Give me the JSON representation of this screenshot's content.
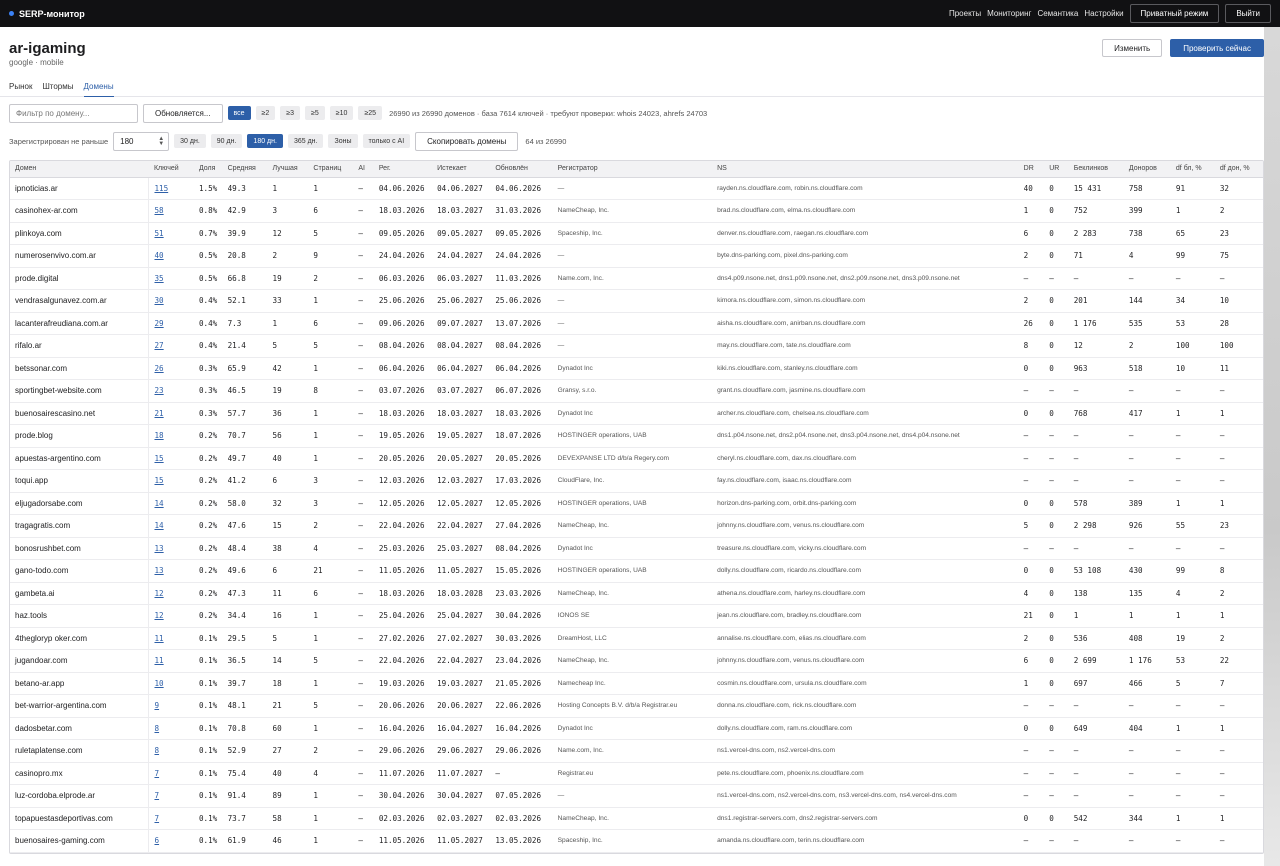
{
  "topbar": {
    "brand": "SERP-монитор",
    "nav": [
      "Проекты",
      "Мониторинг",
      "Семантика",
      "Настройки"
    ],
    "private_mode": "Приватный режим",
    "logout": "Выйти"
  },
  "header": {
    "title": "ar-igaming",
    "subtitle": "google · mobile",
    "edit": "Изменить",
    "check_now": "Проверить сейчас"
  },
  "tabs": [
    "Рынок",
    "Штормы",
    "Домены"
  ],
  "filters": {
    "domain_placeholder": "Фильтр по домену...",
    "updating": "Обновляется...",
    "chips": [
      "все",
      "≥2",
      "≥3",
      "≥5",
      "≥10",
      "≥25"
    ],
    "summary": "26990 из 26990 доменов · база 7614 ключей · требуют проверки: whois 24023, ahrefs 24703",
    "registered_label": "Зарегистрирован не раньше",
    "registered_value": "180",
    "period_chips": [
      "30 дн.",
      "90 дн.",
      "180 дн.",
      "365 дн.",
      "Зоны",
      "только с AI"
    ],
    "copy_domains": "Скопировать домены",
    "shown_count": "64 из 26990"
  },
  "table": {
    "columns": [
      "Домен",
      "Ключей",
      "Доля",
      "Средняя",
      "Лучшая",
      "Страниц",
      "AI",
      "Рег.",
      "Истекает",
      "Обновлён",
      "Регистратор",
      "NS",
      "DR",
      "UR",
      "Беклинков",
      "Доноров",
      "df бл, %",
      "df дон, %"
    ],
    "rows": [
      [
        "ipnoticias.ar",
        "115",
        "1.5%",
        "49.3",
        "1",
        "1",
        "—",
        "04.06.2026",
        "04.06.2027",
        "04.06.2026",
        "—",
        "rayden.ns.cloudflare.com, robin.ns.cloudflare.com",
        "40",
        "0",
        "15 431",
        "758",
        "91",
        "32"
      ],
      [
        "casinohex-ar.com",
        "58",
        "0.8%",
        "42.9",
        "3",
        "6",
        "—",
        "18.03.2026",
        "18.03.2027",
        "31.03.2026",
        "NameCheap, Inc.",
        "brad.ns.cloudflare.com, elma.ns.cloudflare.com",
        "1",
        "0",
        "752",
        "399",
        "1",
        "2"
      ],
      [
        "plinkoya.com",
        "51",
        "0.7%",
        "39.9",
        "12",
        "5",
        "—",
        "09.05.2026",
        "09.05.2027",
        "09.05.2026",
        "Spaceship, Inc.",
        "denver.ns.cloudflare.com, raegan.ns.cloudflare.com",
        "6",
        "0",
        "2 283",
        "738",
        "65",
        "23"
      ],
      [
        "numerosenvivo.com.ar",
        "40",
        "0.5%",
        "20.8",
        "2",
        "9",
        "—",
        "24.04.2026",
        "24.04.2027",
        "24.04.2026",
        "—",
        "byte.dns-parking.com, pixel.dns-parking.com",
        "2",
        "0",
        "71",
        "4",
        "99",
        "75"
      ],
      [
        "prode.digital",
        "35",
        "0.5%",
        "66.8",
        "19",
        "2",
        "—",
        "06.03.2026",
        "06.03.2027",
        "11.03.2026",
        "Name.com, Inc.",
        "dns4.p09.nsone.net, dns1.p09.nsone.net, dns2.p09.nsone.net, dns3.p09.nsone.net",
        "—",
        "—",
        "—",
        "—",
        "—",
        "—"
      ],
      [
        "vendrasalgunavez.com.ar",
        "30",
        "0.4%",
        "52.1",
        "33",
        "1",
        "—",
        "25.06.2026",
        "25.06.2027",
        "25.06.2026",
        "—",
        "kimora.ns.cloudflare.com, simon.ns.cloudflare.com",
        "2",
        "0",
        "201",
        "144",
        "34",
        "10"
      ],
      [
        "lacanterafreudiana.com.ar",
        "29",
        "0.4%",
        "7.3",
        "1",
        "6",
        "—",
        "09.06.2026",
        "09.07.2027",
        "13.07.2026",
        "—",
        "aisha.ns.cloudflare.com, anirban.ns.cloudflare.com",
        "26",
        "0",
        "1 176",
        "535",
        "53",
        "28"
      ],
      [
        "rifalo.ar",
        "27",
        "0.4%",
        "21.4",
        "5",
        "5",
        "—",
        "08.04.2026",
        "08.04.2027",
        "08.04.2026",
        "—",
        "may.ns.cloudflare.com, tate.ns.cloudflare.com",
        "8",
        "0",
        "12",
        "2",
        "100",
        "100"
      ],
      [
        "betssonar.com",
        "26",
        "0.3%",
        "65.9",
        "42",
        "1",
        "—",
        "06.04.2026",
        "06.04.2027",
        "06.04.2026",
        "Dynadot Inc",
        "kiki.ns.cloudflare.com, stanley.ns.cloudflare.com",
        "0",
        "0",
        "963",
        "518",
        "10",
        "11"
      ],
      [
        "sportingbet-website.com",
        "23",
        "0.3%",
        "46.5",
        "19",
        "8",
        "—",
        "03.07.2026",
        "03.07.2027",
        "06.07.2026",
        "Gransy, s.r.o.",
        "grant.ns.cloudflare.com, jasmine.ns.cloudflare.com",
        "—",
        "—",
        "—",
        "—",
        "—",
        "—"
      ],
      [
        "buenosairescasino.net",
        "21",
        "0.3%",
        "57.7",
        "36",
        "1",
        "—",
        "18.03.2026",
        "18.03.2027",
        "18.03.2026",
        "Dynadot Inc",
        "archer.ns.cloudflare.com, chelsea.ns.cloudflare.com",
        "0",
        "0",
        "768",
        "417",
        "1",
        "1"
      ],
      [
        "prode.blog",
        "18",
        "0.2%",
        "70.7",
        "56",
        "1",
        "—",
        "19.05.2026",
        "19.05.2027",
        "18.07.2026",
        "HOSTINGER operations, UAB",
        "dns1.p04.nsone.net, dns2.p04.nsone.net, dns3.p04.nsone.net, dns4.p04.nsone.net",
        "—",
        "—",
        "—",
        "—",
        "—",
        "—"
      ],
      [
        "apuestas-argentino.com",
        "15",
        "0.2%",
        "49.7",
        "40",
        "1",
        "—",
        "20.05.2026",
        "20.05.2027",
        "20.05.2026",
        "DEVEXPANSE LTD d/b/a Regery.com",
        "cheryl.ns.cloudflare.com, dax.ns.cloudflare.com",
        "—",
        "—",
        "—",
        "—",
        "—",
        "—"
      ],
      [
        "toqui.app",
        "15",
        "0.2%",
        "41.2",
        "6",
        "3",
        "—",
        "12.03.2026",
        "12.03.2027",
        "17.03.2026",
        "CloudFlare, Inc.",
        "fay.ns.cloudflare.com, isaac.ns.cloudflare.com",
        "—",
        "—",
        "—",
        "—",
        "—",
        "—"
      ],
      [
        "eljugadorsabe.com",
        "14",
        "0.2%",
        "58.0",
        "32",
        "3",
        "—",
        "12.05.2026",
        "12.05.2027",
        "12.05.2026",
        "HOSTINGER operations, UAB",
        "horizon.dns-parking.com, orbit.dns-parking.com",
        "0",
        "0",
        "578",
        "389",
        "1",
        "1"
      ],
      [
        "tragagratis.com",
        "14",
        "0.2%",
        "47.6",
        "15",
        "2",
        "—",
        "22.04.2026",
        "22.04.2027",
        "27.04.2026",
        "NameCheap, Inc.",
        "johnny.ns.cloudflare.com, venus.ns.cloudflare.com",
        "5",
        "0",
        "2 298",
        "926",
        "55",
        "23"
      ],
      [
        "bonosrushbet.com",
        "13",
        "0.2%",
        "48.4",
        "38",
        "4",
        "—",
        "25.03.2026",
        "25.03.2027",
        "08.04.2026",
        "Dynadot Inc",
        "treasure.ns.cloudflare.com, vicky.ns.cloudflare.com",
        "—",
        "—",
        "—",
        "—",
        "—",
        "—"
      ],
      [
        "gano-todo.com",
        "13",
        "0.2%",
        "49.6",
        "6",
        "21",
        "—",
        "11.05.2026",
        "11.05.2027",
        "15.05.2026",
        "HOSTINGER operations, UAB",
        "dolly.ns.cloudflare.com, ricardo.ns.cloudflare.com",
        "0",
        "0",
        "53 108",
        "430",
        "99",
        "8"
      ],
      [
        "gambeta.ai",
        "12",
        "0.2%",
        "47.3",
        "11",
        "6",
        "—",
        "18.03.2026",
        "18.03.2028",
        "23.03.2026",
        "NameCheap, Inc.",
        "athena.ns.cloudflare.com, harley.ns.cloudflare.com",
        "4",
        "0",
        "138",
        "135",
        "4",
        "2"
      ],
      [
        "haz.tools",
        "12",
        "0.2%",
        "34.4",
        "16",
        "1",
        "—",
        "25.04.2026",
        "25.04.2027",
        "30.04.2026",
        "IONOS SE",
        "jean.ns.cloudflare.com, bradley.ns.cloudflare.com",
        "21",
        "0",
        "1",
        "1",
        "1",
        "1"
      ],
      [
        "4thegloryp oker.com",
        "11",
        "0.1%",
        "29.5",
        "5",
        "1",
        "—",
        "27.02.2026",
        "27.02.2027",
        "30.03.2026",
        "DreamHost, LLC",
        "annalise.ns.cloudflare.com, elias.ns.cloudflare.com",
        "2",
        "0",
        "536",
        "408",
        "19",
        "2"
      ],
      [
        "jugandoar.com",
        "11",
        "0.1%",
        "36.5",
        "14",
        "5",
        "—",
        "22.04.2026",
        "22.04.2027",
        "23.04.2026",
        "NameCheap, Inc.",
        "johnny.ns.cloudflare.com, venus.ns.cloudflare.com",
        "6",
        "0",
        "2 699",
        "1 176",
        "53",
        "22"
      ],
      [
        "betano-ar.app",
        "10",
        "0.1%",
        "39.7",
        "18",
        "1",
        "—",
        "19.03.2026",
        "19.03.2027",
        "21.05.2026",
        "Namecheap Inc.",
        "cosmin.ns.cloudflare.com, ursula.ns.cloudflare.com",
        "1",
        "0",
        "697",
        "466",
        "5",
        "7"
      ],
      [
        "bet-warrior-argentina.com",
        "9",
        "0.1%",
        "48.1",
        "21",
        "5",
        "—",
        "20.06.2026",
        "20.06.2027",
        "22.06.2026",
        "Hosting Concepts B.V. d/b/a Registrar.eu",
        "donna.ns.cloudflare.com, rick.ns.cloudflare.com",
        "—",
        "—",
        "—",
        "—",
        "—",
        "—"
      ],
      [
        "dadosbetar.com",
        "8",
        "0.1%",
        "70.8",
        "60",
        "1",
        "—",
        "16.04.2026",
        "16.04.2027",
        "16.04.2026",
        "Dynadot Inc",
        "dolly.ns.cloudflare.com, ram.ns.cloudflare.com",
        "0",
        "0",
        "649",
        "404",
        "1",
        "1"
      ],
      [
        "ruletaplatense.com",
        "8",
        "0.1%",
        "52.9",
        "27",
        "2",
        "—",
        "29.06.2026",
        "29.06.2027",
        "29.06.2026",
        "Name.com, Inc.",
        "ns1.vercel-dns.com, ns2.vercel-dns.com",
        "—",
        "—",
        "—",
        "—",
        "—",
        "—"
      ],
      [
        "casinopro.mx",
        "7",
        "0.1%",
        "75.4",
        "40",
        "4",
        "—",
        "11.07.2026",
        "11.07.2027",
        "—",
        "Registrar.eu",
        "pete.ns.cloudflare.com, phoenix.ns.cloudflare.com",
        "—",
        "—",
        "—",
        "—",
        "—",
        "—"
      ],
      [
        "luz-cordoba.elprode.ar",
        "7",
        "0.1%",
        "91.4",
        "89",
        "1",
        "—",
        "30.04.2026",
        "30.04.2027",
        "07.05.2026",
        "—",
        "ns1.vercel-dns.com, ns2.vercel-dns.com, ns3.vercel-dns.com, ns4.vercel-dns.com",
        "—",
        "—",
        "—",
        "—",
        "—",
        "—"
      ],
      [
        "topapuestasdeportivas.com",
        "7",
        "0.1%",
        "73.7",
        "58",
        "1",
        "—",
        "02.03.2026",
        "02.03.2027",
        "02.03.2026",
        "NameCheap, Inc.",
        "dns1.registrar-servers.com, dns2.registrar-servers.com",
        "0",
        "0",
        "542",
        "344",
        "1",
        "1"
      ],
      [
        "buenosaires-gaming.com",
        "6",
        "0.1%",
        "61.9",
        "46",
        "1",
        "—",
        "11.05.2026",
        "11.05.2027",
        "13.05.2026",
        "Spaceship, Inc.",
        "amanda.ns.cloudflare.com, terin.ns.cloudflare.com",
        "—",
        "—",
        "—",
        "—",
        "—",
        "—"
      ]
    ]
  }
}
